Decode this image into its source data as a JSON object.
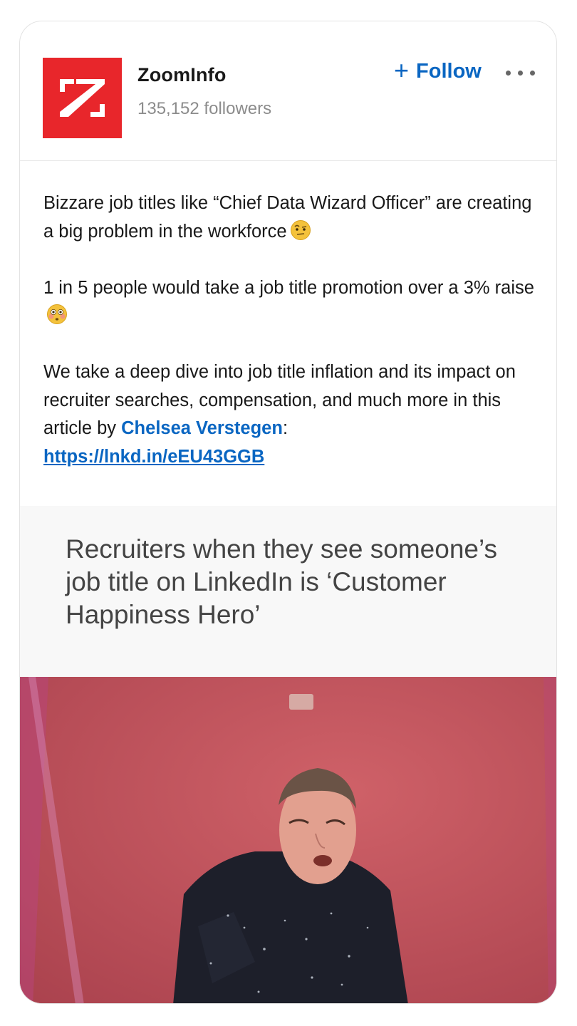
{
  "post": {
    "company": {
      "name": "ZoomInfo",
      "followers": "135,152 followers",
      "logo_color": "#e8262b"
    },
    "follow": {
      "plus": "+",
      "label": "Follow"
    },
    "more_icon": "more-horizontal-icon",
    "text": {
      "p1": "Bizzare job titles like “Chief Data Wizard Officer” are creating a big problem in the workforce",
      "p1_emoji": "raised-eyebrow-emoji",
      "p2": "1 in 5 people would take a job title promotion over a 3% raise",
      "p2_emoji": "flushed-face-emoji",
      "p3": "We take a deep dive into job title inflation and its impact on recruiter searches, compensation, and much more in this article by",
      "mention": "Chelsea Verstegen",
      "colon": ":",
      "link": "https://lnkd.in/eEU43GGB"
    },
    "media": {
      "caption": "Recruiters when they see someone’s job title on LinkedIn is ‘Customer Happiness Hero’"
    }
  },
  "colors": {
    "accent": "#0a66c2",
    "text": "#191919",
    "muted": "#8c8c8c",
    "gif_background": "#c2555e"
  }
}
